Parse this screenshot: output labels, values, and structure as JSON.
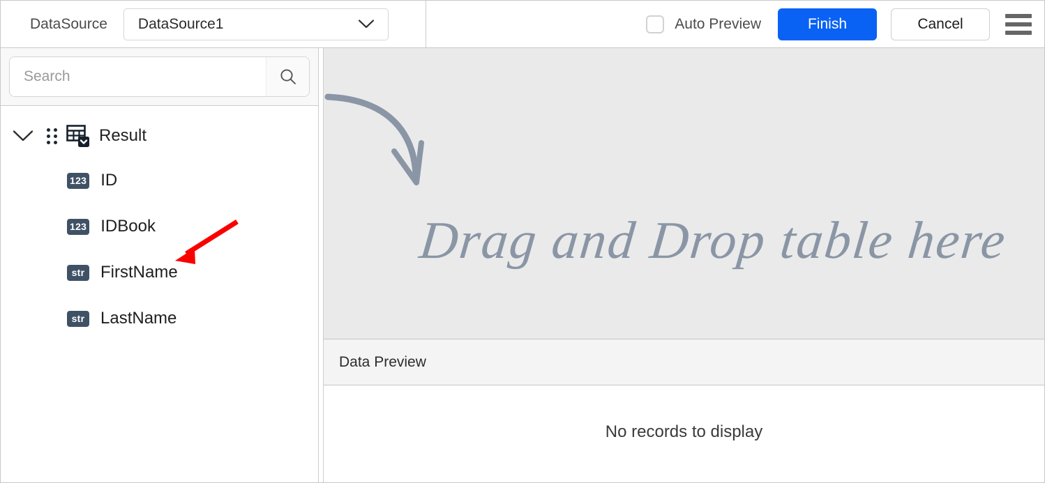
{
  "topbar": {
    "datasource_label": "DataSource",
    "datasource_value": "DataSource1",
    "datasource_chevron_icon": "chevron-down-icon",
    "auto_preview_label": "Auto Preview",
    "auto_preview_checked": false,
    "finish_label": "Finish",
    "cancel_label": "Cancel",
    "menu_icon": "hamburger-menu-icon",
    "accent_color": "#0a62f5"
  },
  "sidebar": {
    "search": {
      "placeholder": "Search",
      "value": "",
      "icon": "search-icon"
    },
    "tree": {
      "expand_icon": "chevron-down-icon",
      "drag_handle_icon": "drag-dots-icon",
      "node_icon": "table-dropdown-icon",
      "node_label": "Result",
      "expanded": true,
      "fields": [
        {
          "type": "123",
          "label": "ID"
        },
        {
          "type": "123",
          "label": "IDBook"
        },
        {
          "type": "str",
          "label": "FirstName"
        },
        {
          "type": "str",
          "label": "LastName"
        }
      ],
      "badge_color": "#3f5165"
    },
    "annotation": {
      "icon": "red-arrow-annotation",
      "color": "#fb0000"
    }
  },
  "main": {
    "dropzone": {
      "text": "Drag and Drop table here",
      "arrow_icon": "curved-arrow-icon",
      "background": "#eaeaea",
      "text_color": "#8a96a5"
    },
    "preview": {
      "title": "Data Preview",
      "empty_message": "No records to display"
    }
  }
}
